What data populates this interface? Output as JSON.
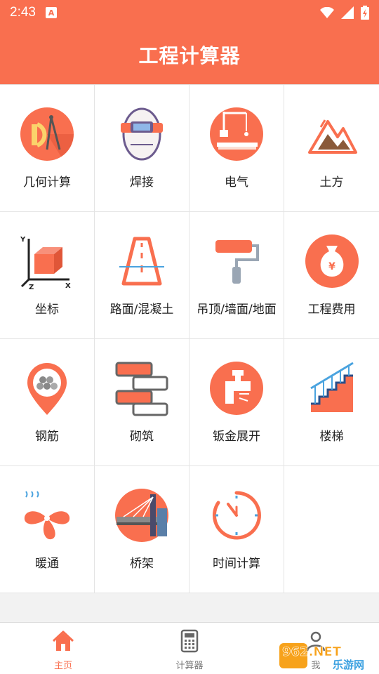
{
  "status": {
    "time": "2:43",
    "notification_letter": "A"
  },
  "header": {
    "title": "工程计算器"
  },
  "grid": [
    {
      "label": "几何计算",
      "icon": "geometry-compass-icon"
    },
    {
      "label": "焊接",
      "icon": "welding-mask-icon"
    },
    {
      "label": "电气",
      "icon": "electric-lamp-icon"
    },
    {
      "label": "土方",
      "icon": "earthwork-mountain-icon"
    },
    {
      "label": "坐标",
      "icon": "coordinate-cube-icon"
    },
    {
      "label": "路面/混凝土",
      "icon": "road-icon"
    },
    {
      "label": "吊顶/墙面/地面",
      "icon": "paint-roller-icon"
    },
    {
      "label": "工程费用",
      "icon": "money-bag-icon"
    },
    {
      "label": "钢筋",
      "icon": "rebar-pin-icon"
    },
    {
      "label": "砌筑",
      "icon": "bricks-icon"
    },
    {
      "label": "钣金展开",
      "icon": "faucet-icon"
    },
    {
      "label": "楼梯",
      "icon": "stairs-icon"
    },
    {
      "label": "暖通",
      "icon": "hvac-fan-icon"
    },
    {
      "label": "桥架",
      "icon": "bridge-icon"
    },
    {
      "label": "时间计算",
      "icon": "clock-icon"
    }
  ],
  "tabs": [
    {
      "label": "主页",
      "icon": "home-icon",
      "active": true
    },
    {
      "label": "计算器",
      "icon": "calculator-icon",
      "active": false
    },
    {
      "label": "我",
      "icon": "user-icon",
      "active": false
    }
  ],
  "watermark": {
    "text_top": "962.NET",
    "text_bottom": "乐游网"
  },
  "colors": {
    "accent": "#f96f4f",
    "text": "#222222",
    "muted": "#777777"
  }
}
